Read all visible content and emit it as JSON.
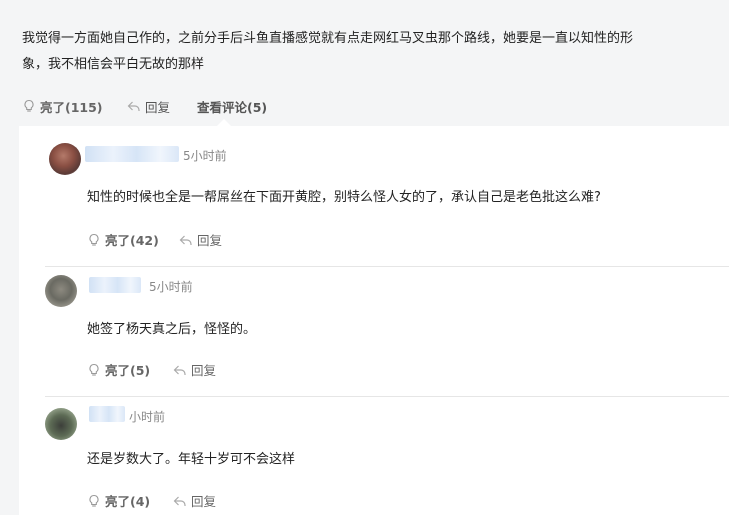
{
  "post": {
    "text_line1": "我觉得一方面她自己作的，之前分手后斗鱼直播感觉就有点走网红马叉虫那个路线，她要是一直以知性的形",
    "text_line2": "象，我不相信会平白无故的那样",
    "like_label": "亮了(115)",
    "reply_label": "回复",
    "view_comments_label": "查看评论(5)"
  },
  "comments": [
    {
      "time": "5小时前",
      "text": "知性的时候也全是一帮屌丝在下面开黄腔，别特么怪人女的了，承认自己是老色批这么难?",
      "like_label": "亮了(42)",
      "reply_label": "回复"
    },
    {
      "time": "5小时前",
      "text": "她签了杨天真之后，怪怪的。",
      "like_label": "亮了(5)",
      "reply_label": "回复"
    },
    {
      "time": "小时前",
      "text": "还是岁数大了。年轻十岁可不会这样",
      "like_label": "亮了(4)",
      "reply_label": "回复"
    }
  ],
  "icons": {
    "like": "lightbulb-icon",
    "reply": "reply-arrow-icon"
  },
  "colors": {
    "page_bg": "#f4f5f6",
    "panel_bg": "#ffffff",
    "text": "#222222",
    "muted": "#888888"
  }
}
